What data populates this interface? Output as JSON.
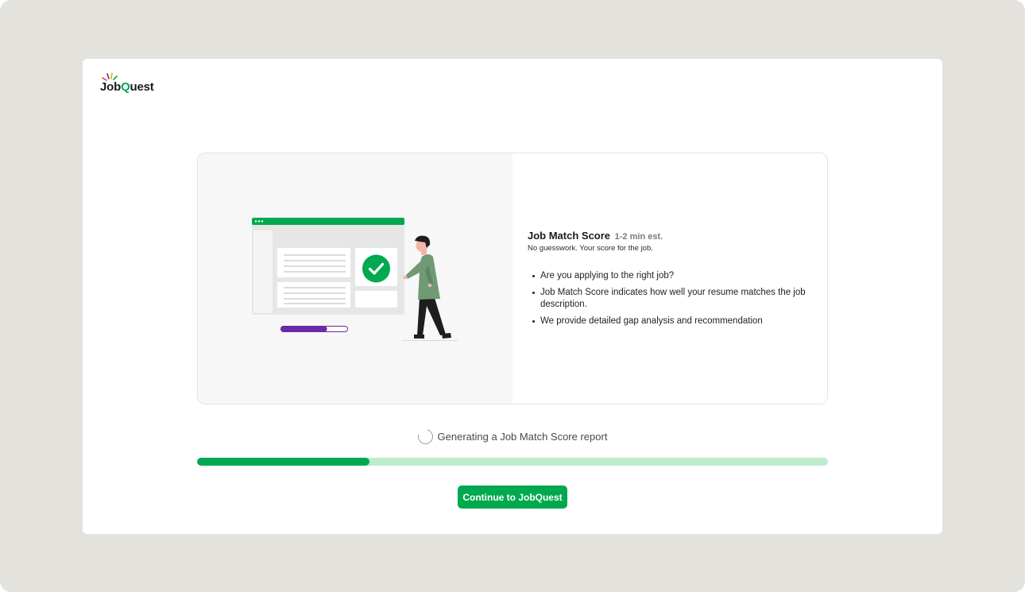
{
  "brand": {
    "name_prefix": "Job",
    "name_q": "Q",
    "name_suffix": "uest"
  },
  "card": {
    "title": "Job Match Score",
    "estimate": "1-2 min est.",
    "subtitle": "No guesswork. Your score for the job.",
    "bullets": [
      "Are you applying to the right job?",
      "Job Match Score indicates how well your resume matches the job description.",
      "We provide detailed gap analysis and recommendation"
    ]
  },
  "status": {
    "text": "Generating a Job Match Score report"
  },
  "progress": {
    "fraction": 0.273
  },
  "illustration": {
    "progress_fraction": 0.69
  },
  "cta": {
    "label": "Continue to JobQuest"
  },
  "colors": {
    "accent": "#00a94f",
    "accent_light": "#bdeccd",
    "backdrop": "#e3e2dd",
    "illustration_purple": "#6a2aa6",
    "person_shirt": "#6f9a73"
  },
  "icons": [
    "logo-sparkle-icon",
    "checkmark-icon",
    "spinner-icon"
  ]
}
